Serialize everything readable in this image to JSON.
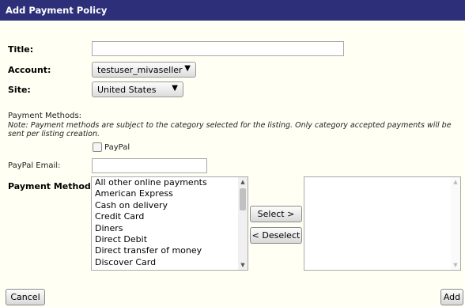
{
  "dialog": {
    "title": "Add Payment Policy"
  },
  "form": {
    "title_label": "Title:",
    "title_value": "",
    "account_label": "Account:",
    "account_value": "testuser_mivaseller",
    "site_label": "Site:",
    "site_value": "United States",
    "payment_methods_heading": "Payment Methods:",
    "note": "Note: Payment methods are subject to the category selected for the listing. Only category accepted payments will be sent per listing creation.",
    "paypal_checkbox_label": "PayPal",
    "paypal_checked": false,
    "paypal_email_label": "PayPal Email:",
    "paypal_email_value": "",
    "payment_methods_label": "Payment Methods:"
  },
  "available_methods": [
    "All other online payments",
    "American Express",
    "Cash on delivery",
    "Credit Card",
    "Diners",
    "Direct Debit",
    "Direct transfer of money",
    "Discover Card"
  ],
  "selected_methods": [],
  "buttons": {
    "select": "Select >",
    "deselect": "< Deselect",
    "cancel": "Cancel",
    "add": "Add"
  },
  "icons": {
    "dropdown_arrow": "▼",
    "scroll_up": "▲",
    "scroll_down": "▼"
  },
  "colors": {
    "titlebar": "#2d2f79",
    "background": "#fffff4"
  }
}
